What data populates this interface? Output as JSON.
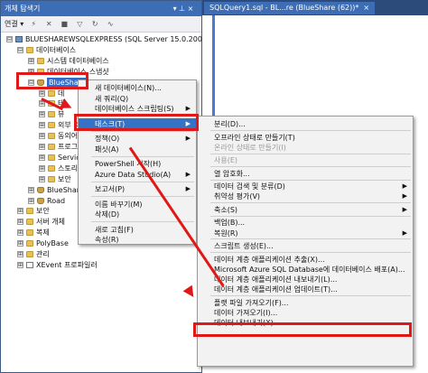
{
  "object_explorer": {
    "title": "개체 탐색기",
    "pin": "▾ ⊥ ×",
    "toolbar_connect": "연결 ▾",
    "tree": [
      {
        "label": "BLUESHAREWSQLEXPRESS (SQL Server 15.0.2000 - BlueS",
        "sign": "⊟",
        "icon": "server"
      },
      {
        "label": "데이터베이스",
        "sign": "⊟",
        "icon": "folder"
      },
      {
        "label": "시스템 데이터베이스",
        "sign": "⊞",
        "icon": "folder"
      },
      {
        "label": "데이터베이스 스냅샷",
        "sign": "⊞",
        "icon": "folder"
      },
      {
        "label": "BlueShare",
        "sign": "⊟",
        "icon": "db"
      },
      {
        "label": "데",
        "sign": "⊞",
        "icon": "folder"
      },
      {
        "label": "테",
        "sign": "⊞",
        "icon": "folder"
      },
      {
        "label": "뷰",
        "sign": "⊞",
        "icon": "folder"
      },
      {
        "label": "외부 리",
        "sign": "⊞",
        "icon": "folder"
      },
      {
        "label": "동의어",
        "sign": "⊞",
        "icon": "folder"
      },
      {
        "label": "프로그래",
        "sign": "⊞",
        "icon": "folder"
      },
      {
        "label": "Service B",
        "sign": "⊞",
        "icon": "folder"
      },
      {
        "label": "스토리지",
        "sign": "⊞",
        "icon": "folder"
      },
      {
        "label": "보안",
        "sign": "⊞",
        "icon": "folder"
      },
      {
        "label": "BlueShare_2",
        "sign": "⊞",
        "icon": "db"
      },
      {
        "label": "Road",
        "sign": "⊞",
        "icon": "db"
      },
      {
        "label": "보안",
        "sign": "⊞",
        "icon": "folder"
      },
      {
        "label": "서버 개체",
        "sign": "⊞",
        "icon": "folder"
      },
      {
        "label": "복제",
        "sign": "⊞",
        "icon": "folder"
      },
      {
        "label": "PolyBase",
        "sign": "⊞",
        "icon": "folder"
      },
      {
        "label": "관리",
        "sign": "⊞",
        "icon": "folder"
      },
      {
        "label": "XEvent 프로파일러",
        "sign": "⊞",
        "icon": "xev"
      }
    ]
  },
  "editor": {
    "tab_label": "SQLQuery1.sql - BL...re (BlueShare (62))*",
    "tab_close": "×"
  },
  "context_menu": [
    {
      "label": "새 데이터베이스(N)...",
      "arrow": ""
    },
    {
      "label": "새 쿼리(Q)",
      "arrow": ""
    },
    {
      "label": "데이터베이스 스크립팅(S)",
      "arrow": "▶"
    },
    {
      "sep": true
    },
    {
      "label": "태스크(T)",
      "arrow": "▶",
      "highlight": true
    },
    {
      "sep": true
    },
    {
      "label": "정책(O)",
      "arrow": "▶"
    },
    {
      "label": "패싯(A)",
      "arrow": ""
    },
    {
      "sep": true
    },
    {
      "label": "PowerShell 시작(H)",
      "arrow": ""
    },
    {
      "label": "Azure Data Studio(A)",
      "arrow": "▶"
    },
    {
      "sep": true
    },
    {
      "label": "보고서(P)",
      "arrow": "▶"
    },
    {
      "sep": true
    },
    {
      "label": "이름 바꾸기(M)",
      "arrow": ""
    },
    {
      "label": "삭제(D)",
      "arrow": ""
    },
    {
      "sep": true
    },
    {
      "label": "새로 고침(F)",
      "arrow": ""
    },
    {
      "label": "속성(R)",
      "arrow": ""
    }
  ],
  "tasks_menu": [
    {
      "label": "분리(D)...",
      "arrow": ""
    },
    {
      "sep": true
    },
    {
      "label": "오프라인 상태로 만들기(T)",
      "arrow": ""
    },
    {
      "label": "온라인 상태로 만들기(I)",
      "arrow": "",
      "disabled": true
    },
    {
      "sep": true
    },
    {
      "label": "사용(E)",
      "arrow": "",
      "disabled": true
    },
    {
      "sep": true
    },
    {
      "label": "열 암호화...",
      "arrow": ""
    },
    {
      "sep": true
    },
    {
      "label": "데이터 검색 및 분류(D)",
      "arrow": "▶"
    },
    {
      "label": "취약성 평가(V)",
      "arrow": "▶"
    },
    {
      "sep": true
    },
    {
      "label": "축소(S)",
      "arrow": "▶"
    },
    {
      "sep": true
    },
    {
      "label": "백업(B)...",
      "arrow": ""
    },
    {
      "label": "복원(R)",
      "arrow": "▶"
    },
    {
      "sep": true
    },
    {
      "label": "스크립트 생성(E)...",
      "arrow": ""
    },
    {
      "sep": true
    },
    {
      "label": "데이터 계층 애플리케이션 추출(X)...",
      "arrow": ""
    },
    {
      "label": "Microsoft Azure SQL Database에 데이터베이스 배포(A)...",
      "arrow": ""
    },
    {
      "label": "데이터 계층 애플리케이션 내보내기(L)...",
      "arrow": ""
    },
    {
      "label": "데이터 계층 애플리케이션 업데이트(T)...",
      "arrow": ""
    },
    {
      "sep": true
    },
    {
      "label": "플랫 파일 가져오기(F)...",
      "arrow": ""
    },
    {
      "label": "데이터 가져오기(I)...",
      "arrow": ""
    },
    {
      "label": "데이터 내보내기(X)...",
      "arrow": ""
    }
  ]
}
